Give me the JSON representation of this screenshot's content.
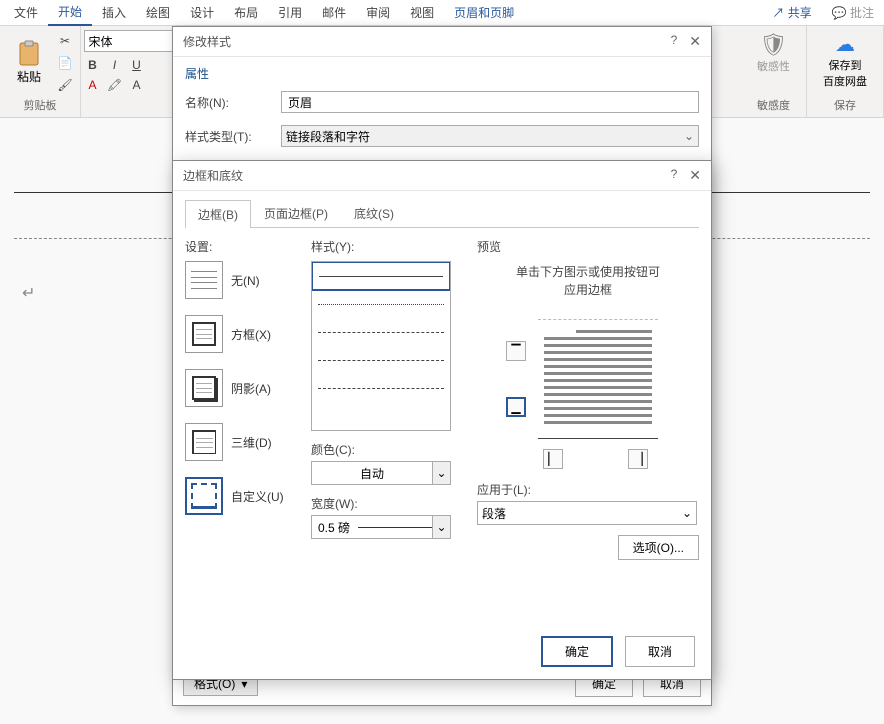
{
  "ribbon": {
    "tabs": [
      "文件",
      "开始",
      "插入",
      "绘图",
      "设计",
      "布局",
      "引用",
      "邮件",
      "审阅",
      "视图",
      "页眉和页脚"
    ],
    "active_tab": "开始",
    "share": "共享",
    "comments": "批注",
    "font_name": "宋体",
    "paste": "粘贴",
    "clipboard_group": "剪贴板",
    "sensitivity": "敏感性",
    "sensitivity_group": "敏感度",
    "save_to": "保存到\n百度网盘",
    "save_group": "保存"
  },
  "modify_dialog": {
    "title": "修改样式",
    "section_props": "属性",
    "label_name": "名称(N):",
    "name_value": "页眉",
    "label_type": "样式类型(T):",
    "type_value": "链接段落和字符",
    "format_btn": "格式(O)",
    "ok": "确定",
    "cancel": "取消"
  },
  "borders_dialog": {
    "title": "边框和底纹",
    "tabs": {
      "border": "边框(B)",
      "page_border": "页面边框(P)",
      "shading": "底纹(S)"
    },
    "settings_heading": "设置:",
    "settings": {
      "none": "无(N)",
      "box": "方框(X)",
      "shadow": "阴影(A)",
      "threeD": "三维(D)",
      "custom": "自定义(U)"
    },
    "style_heading": "样式(Y):",
    "color_heading": "颜色(C):",
    "color_value": "自动",
    "width_heading": "宽度(W):",
    "width_value": "0.5 磅",
    "preview_heading": "预览",
    "preview_hint_1": "单击下方图示或使用按钮可",
    "preview_hint_2": "应用边框",
    "applyto_label": "应用于(L):",
    "applyto_value": "段落",
    "options_btn": "选项(O)...",
    "ok": "确定",
    "cancel": "取消"
  }
}
